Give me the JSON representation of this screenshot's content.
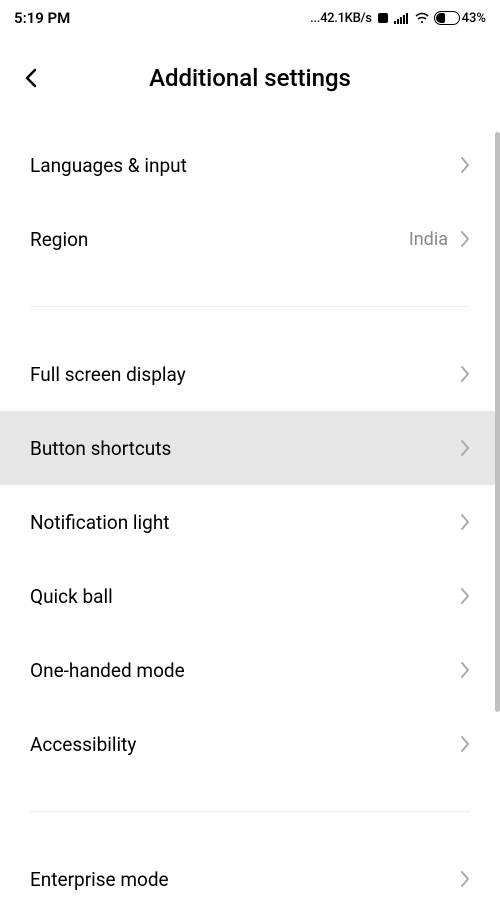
{
  "status_bar": {
    "time": "5:19 PM",
    "speed": "...42.1KB/s",
    "battery_percent": "43%"
  },
  "header": {
    "title": "Additional settings"
  },
  "items": {
    "languages": {
      "label": "Languages & input"
    },
    "region": {
      "label": "Region",
      "value": "India"
    },
    "fullscreen": {
      "label": "Full screen display"
    },
    "button_shortcuts": {
      "label": "Button shortcuts"
    },
    "notification_light": {
      "label": "Notification light"
    },
    "quick_ball": {
      "label": "Quick ball"
    },
    "one_handed": {
      "label": "One-handed mode"
    },
    "accessibility": {
      "label": "Accessibility"
    },
    "enterprise": {
      "label": "Enterprise mode"
    }
  }
}
